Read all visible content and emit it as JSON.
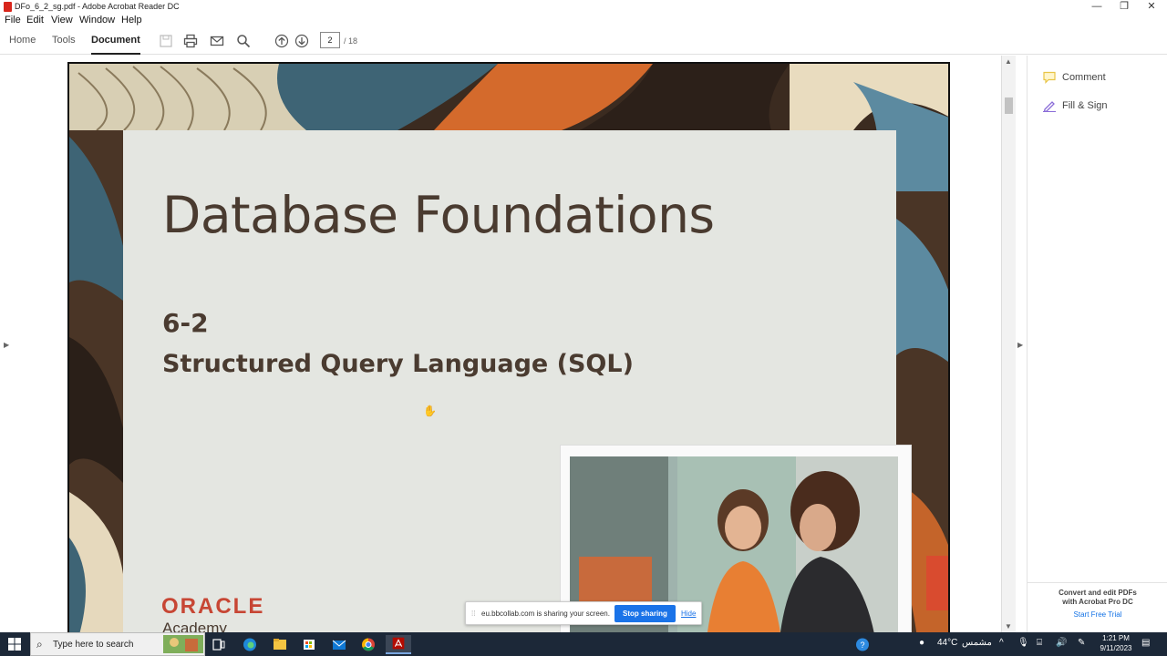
{
  "window": {
    "title": "DFo_6_2_sg.pdf - Adobe Acrobat Reader DC",
    "minimize": "—",
    "restore": "❐",
    "close": "✕"
  },
  "menu": [
    "File",
    "Edit",
    "View",
    "Window",
    "Help"
  ],
  "toolbar": {
    "tabs": [
      "Home",
      "Tools",
      "Document"
    ],
    "active_tab": "Document",
    "page_current": "2",
    "page_total": "/ 18"
  },
  "slide": {
    "title": "Database Foundations",
    "number": "6-2",
    "subtitle": "Structured Query Language (SQL)",
    "logo_text": "ORACLE",
    "logo_sub": "Academy"
  },
  "right_pane": {
    "comment": "Comment",
    "fill_sign": "Fill & Sign",
    "promo_line1": "Convert and edit PDFs",
    "promo_line2": "with Acrobat Pro DC",
    "trial": "Start Free Trial"
  },
  "share_banner": {
    "message": "eu.bbcollab.com is sharing your screen.",
    "stop": "Stop sharing",
    "hide": "Hide"
  },
  "taskbar": {
    "search_placeholder": "Type here to search",
    "weather": "44°C",
    "weather_desc": "مشمس",
    "time": "1:21 PM",
    "date": "9/11/2023"
  },
  "colors": {
    "slide_text": "#4a3b30",
    "oracle_red": "#c74634",
    "taskbar": "#1c2838",
    "share_button": "#1a73e8"
  }
}
